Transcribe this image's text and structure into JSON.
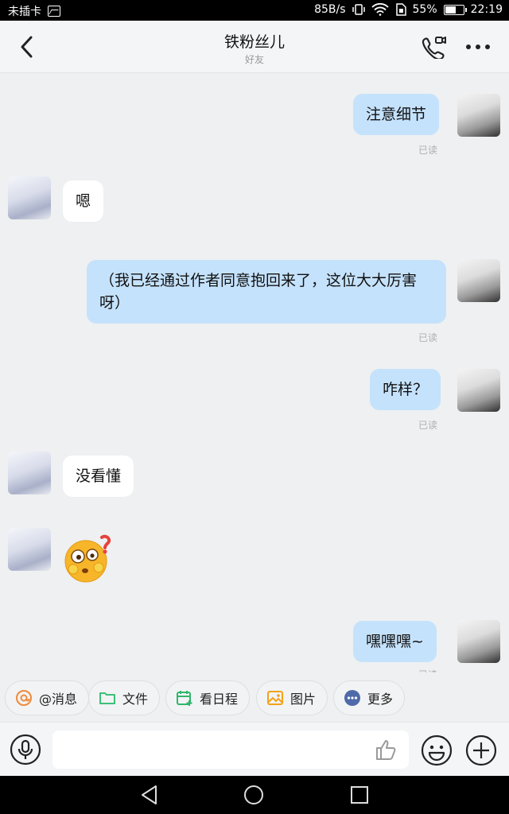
{
  "status_bar": {
    "carrier": "未插卡",
    "net_speed": "85B/s",
    "battery": "55%",
    "battery_level": 0.55,
    "time": "22:19"
  },
  "header": {
    "title": "铁粉丝儿",
    "subtitle": "好友"
  },
  "messages": [
    {
      "from": "me",
      "text": "注意细节",
      "read": "已读"
    },
    {
      "from": "them",
      "text": "嗯"
    },
    {
      "from": "me",
      "text": "（我已经通过作者同意抱回来了，这位大大厉害呀）",
      "read": "已读"
    },
    {
      "from": "me",
      "text": "咋样？",
      "read": "已读"
    },
    {
      "from": "them",
      "text": "没看懂"
    },
    {
      "from": "them",
      "emoji": "flushed-question-emoji"
    },
    {
      "from": "me",
      "text": "嘿嘿嘿~",
      "read": "已读"
    }
  ],
  "tools": [
    {
      "label": "@消息",
      "icon": "at-icon",
      "color": "#f08a3c"
    },
    {
      "label": "文件",
      "icon": "folder-icon",
      "color": "#3cc07a"
    },
    {
      "label": "看日程",
      "icon": "calendar-add-icon",
      "color": "#2fb66a"
    },
    {
      "label": "图片",
      "icon": "image-icon",
      "color": "#f3a21a"
    },
    {
      "label": "更多",
      "icon": "more-icon",
      "color": "#4f6aa8"
    }
  ],
  "input": {
    "placeholder": ""
  }
}
